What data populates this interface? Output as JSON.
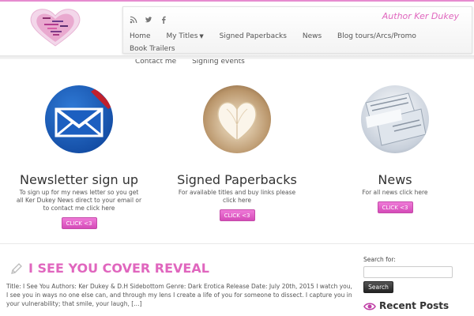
{
  "header": {
    "site_title": "Author Ker Dukey",
    "social_icons": [
      "rss-icon",
      "twitter-icon",
      "facebook-icon"
    ],
    "menu_row1": [
      {
        "label": "Home"
      },
      {
        "label": "My Titles",
        "has_dropdown": true
      },
      {
        "label": "Signed Paperbacks"
      },
      {
        "label": "News"
      },
      {
        "label": "Blog tours/Arcs/Promo"
      },
      {
        "label": "Book Trailers"
      }
    ],
    "menu_row2": [
      {
        "label": "Contact me"
      },
      {
        "label": "Signing events"
      }
    ]
  },
  "featured": [
    {
      "title": "Newsletter sign up",
      "text": "To sign up for my news letter so you get all Ker Dukey News direct to your email or to contact me click here",
      "button": "CLICK <3",
      "icon": "envelope-icon"
    },
    {
      "title": "Signed Paperbacks",
      "text": "For available titles and buy links please click here",
      "button": "CLICK <3",
      "icon": "book-heart-icon"
    },
    {
      "title": "News",
      "text": "For all news click here",
      "button": "CLICK <3",
      "icon": "newspaper-icon"
    }
  ],
  "post": {
    "title": "I SEE YOU COVER REVEAL",
    "excerpt": "Title: I See You Authors: Ker Dukey & D.H Sidebottom Genre: Dark Erotica Release Date: July 20th, 2015   I watch you, I see you in ways no one else can, and through my lens I create a life of you for someone to dissect. I capture you in your vulnerability; that smile, your laugh, […]"
  },
  "sidebar": {
    "search_label": "Search for:",
    "search_value": "",
    "search_button": "Search",
    "recent_posts_title": "Recent Posts"
  },
  "colors": {
    "accent": "#e066be",
    "button_pink": "#e05fc4",
    "topline": "#e68bd0"
  }
}
